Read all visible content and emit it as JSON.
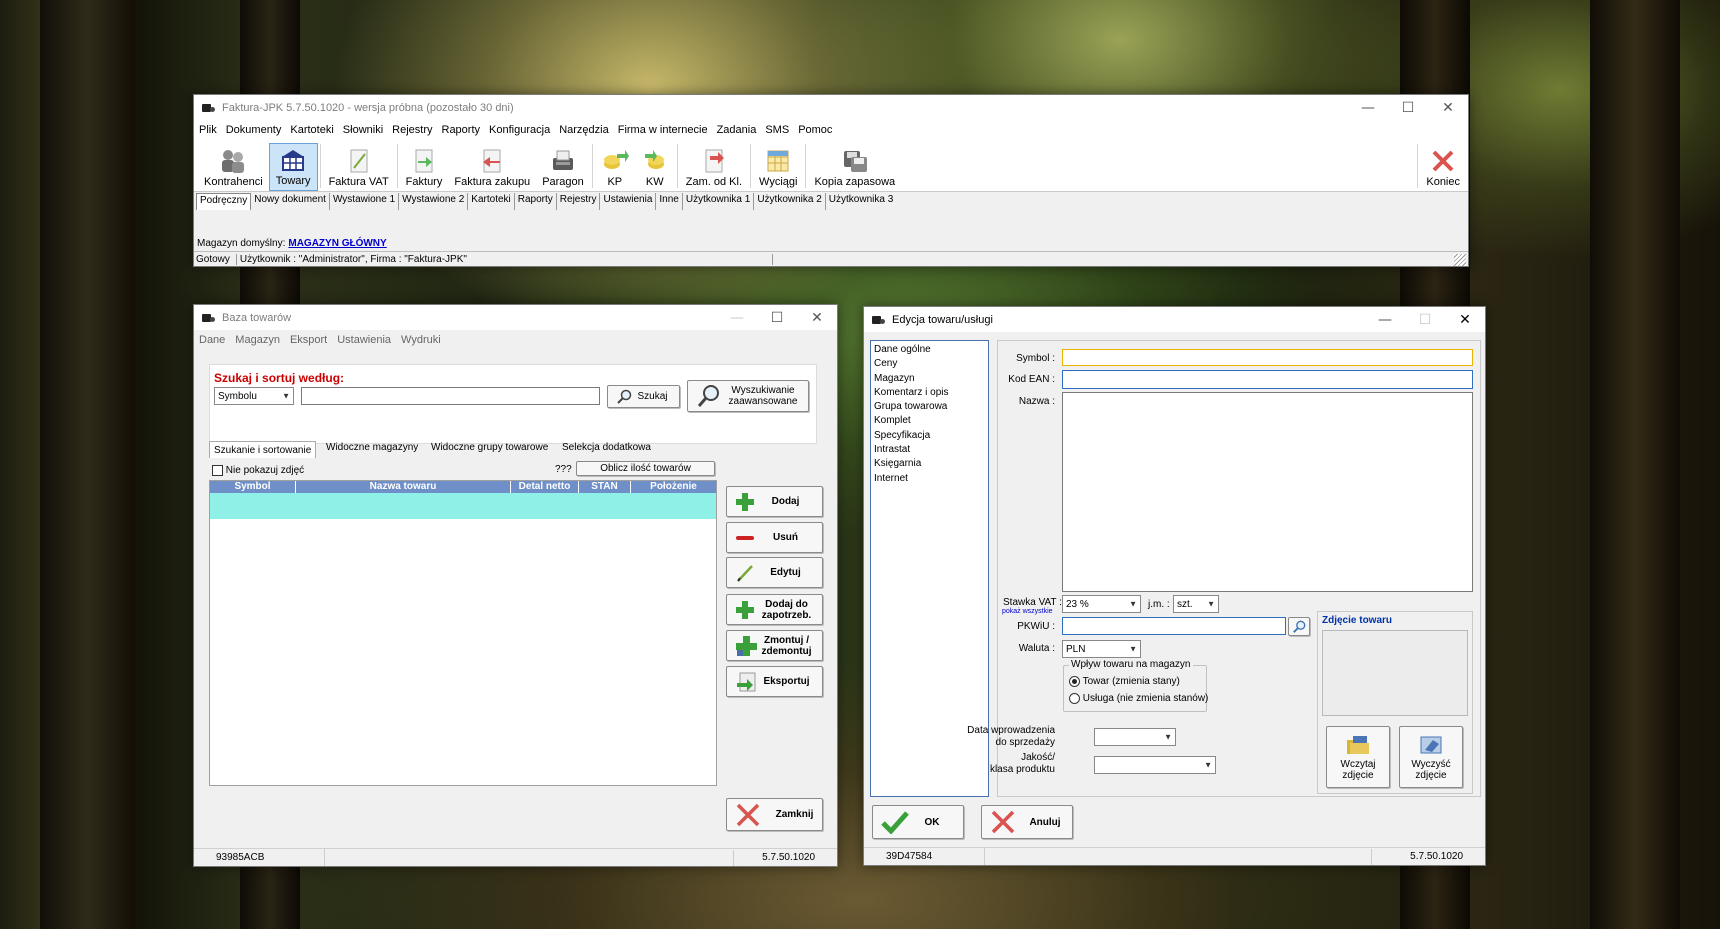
{
  "main_window": {
    "title": "Faktura-JPK 5.7.50.1020 - wersja próbna (pozostało 30 dni)",
    "menu": [
      "Plik",
      "Dokumenty",
      "Kartoteki",
      "Słowniki",
      "Rejestry",
      "Raporty",
      "Konfiguracja",
      "Narzędzia",
      "Firma w internecie",
      "Zadania",
      "SMS",
      "Pomoc"
    ],
    "toolbar": [
      {
        "label": "Kontrahenci",
        "icon": "contractors-icon"
      },
      {
        "label": "Towary",
        "icon": "goods-icon",
        "selected": true
      },
      {
        "label": "Faktura VAT",
        "icon": "vat-invoice-icon"
      },
      {
        "label": "Faktury",
        "icon": "invoices-icon"
      },
      {
        "label": "Faktura zakupu",
        "icon": "purchase-invoice-icon"
      },
      {
        "label": "Paragon",
        "icon": "receipt-icon"
      },
      {
        "label": "KP",
        "icon": "cash-in-icon"
      },
      {
        "label": "KW",
        "icon": "cash-out-icon"
      },
      {
        "label": "Zam. od Kl.",
        "icon": "customer-order-icon"
      },
      {
        "label": "Wyciągi",
        "icon": "statements-icon"
      },
      {
        "label": "Kopia zapasowa",
        "icon": "backup-icon"
      }
    ],
    "exit_label": "Koniec",
    "tabs": [
      "Podręczny",
      "Nowy dokument",
      "Wystawione 1",
      "Wystawione 2",
      "Kartoteki",
      "Raporty",
      "Rejestry",
      "Ustawienia",
      "Inne",
      "Użytkownika 1",
      "Użytkownika 2",
      "Użytkownika 3"
    ],
    "default_warehouse_label": "Magazyn domyślny:",
    "default_warehouse_value": "MAGAZYN GŁÓWNY",
    "status_ready": "Gotowy",
    "status_user": "Użytkownik : \"Administrator\", Firma : \"Faktura-JPK\""
  },
  "goods_window": {
    "title": "Baza towarów",
    "menu": [
      "Dane",
      "Magazyn",
      "Eksport",
      "Ustawienia",
      "Wydruki"
    ],
    "search_heading": "Szukaj i sortuj według:",
    "search_field_value": "Symbolu",
    "search_query": "",
    "search_button": "Szukaj",
    "advanced_search_button": "Wyszukiwanie zaawansowane",
    "tabs": [
      "Szukanie i sortowanie",
      "Widoczne magazyny",
      "Widoczne grupy towarowe",
      "Selekcja dodatkowa"
    ],
    "hide_photos_label": "Nie pokazuj zdjęć",
    "count_unknown": "???",
    "count_button": "Oblicz ilość towarów",
    "columns": [
      "Symbol",
      "Nazwa towaru",
      "Detal netto",
      "STAN",
      "Położenie"
    ],
    "buttons": {
      "add": "Dodaj",
      "remove": "Usuń",
      "edit": "Edytuj",
      "add_to_needs": "Dodaj do zapotrzeb.",
      "assemble": "Zmontuj / zdemontuj",
      "export": "Eksportuj",
      "close": "Zamknij"
    },
    "footer_code": "93985ACB",
    "footer_version": "5.7.50.1020"
  },
  "edit_window": {
    "title": "Edycja towaru/usługi",
    "nav_items": [
      "Dane ogólne",
      "Ceny",
      "Magazyn",
      "Komentarz i opis",
      "Grupa towarowa",
      "Komplet",
      "Specyfikacja",
      "Intrastat",
      "Księgarnia",
      "Internet"
    ],
    "symbol_label": "Symbol :",
    "symbol_value": "",
    "ean_label": "Kod EAN :",
    "ean_value": "",
    "name_label": "Nazwa :",
    "name_value": "",
    "vat_label": "Stawka VAT :",
    "vat_show_all": "pokaż wszystkie",
    "vat_value": "23 %",
    "unit_label": "j.m. :",
    "unit_value": "szt.",
    "pkwiu_label": "PKWiU :",
    "pkwiu_value": "",
    "currency_label": "Waluta :",
    "currency_value": "PLN",
    "impact_group_label": "Wpływ towaru na magazyn",
    "radio_goods": "Towar (zmienia stany)",
    "radio_service": "Usługa (nie zmienia stanów)",
    "radio_selected": "goods",
    "sale_date_label_1": "Data wprowadzenia",
    "sale_date_label_2": "do sprzedaży",
    "sale_date_value": "",
    "quality_label_1": "Jakość/",
    "quality_label_2": "klasa produktu",
    "quality_value": "",
    "photo_heading": "Zdjęcie towaru",
    "load_photo_button": "Wczytaj zdjęcie",
    "clear_photo_button": "Wyczyść zdjęcie",
    "ok_button": "OK",
    "cancel_button": "Anuluj",
    "footer_code": "39D47584",
    "footer_version": "5.7.50.1020"
  },
  "colors": {
    "selected_row": "#8ff0e8",
    "search_heading": "#cc0000",
    "link_blue": "#0000cc",
    "photo_heading": "#0033aa",
    "focus_border": "#e8b400"
  }
}
